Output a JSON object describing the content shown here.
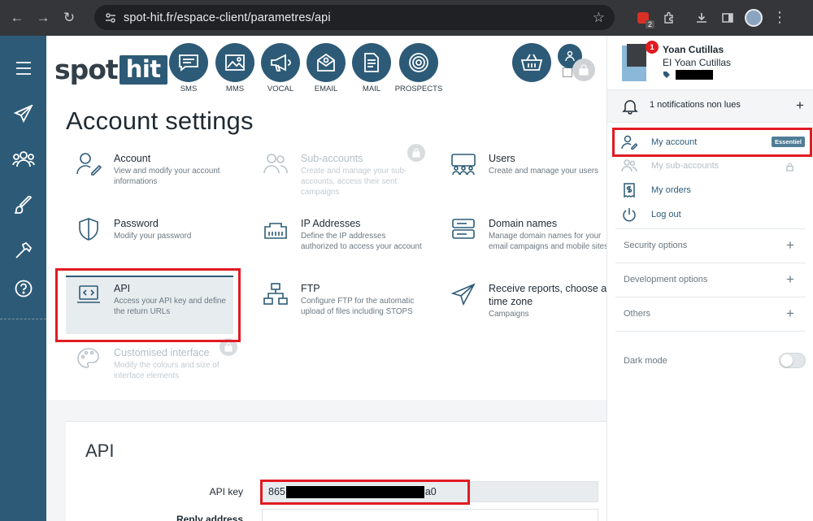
{
  "browser": {
    "url": "spot-hit.fr/espace-client/parametres/api",
    "extension_badge": "2"
  },
  "logo": {
    "part1": "spot",
    "part2": "hit"
  },
  "services": [
    {
      "label": "SMS",
      "icon": "sms-icon"
    },
    {
      "label": "MMS",
      "icon": "image-icon"
    },
    {
      "label": "VOCAL",
      "icon": "megaphone-icon"
    },
    {
      "label": "EMAIL",
      "icon": "email-icon"
    },
    {
      "label": "MAIL",
      "icon": "letter-icon"
    },
    {
      "label": "PROSPECTS",
      "icon": "target-icon"
    }
  ],
  "page": {
    "title": "Account settings"
  },
  "tiles": [
    {
      "title": "Account",
      "desc": "View and modify your account informations",
      "icon": "user-edit-icon"
    },
    {
      "title": "Sub-accounts",
      "desc": "Create and manage your sub-accounts, access their sent campaigns",
      "icon": "users-icon",
      "disabled": true
    },
    {
      "title": "Users",
      "desc": "Create and manage your users",
      "icon": "team-icon"
    },
    {
      "title": "Password",
      "desc": "Modify your password",
      "icon": "shield-icon"
    },
    {
      "title": "IP Addresses",
      "desc": "Define the IP addresses authorized to access your account",
      "icon": "network-port-icon"
    },
    {
      "title": "Domain names",
      "desc": "Manage domain names for your email campaigns and mobile sites",
      "icon": "server-icon"
    },
    {
      "title": "API",
      "desc": "Access your API key and define the return URLs",
      "icon": "code-laptop-icon"
    },
    {
      "title": "FTP",
      "desc": "Configure FTP for the automatic upload of files including STOPS",
      "icon": "ftp-network-icon"
    },
    {
      "title": "Receive reports, choose a time zone",
      "desc": "Campaigns",
      "icon": "paper-plane-icon"
    },
    {
      "title": "Customised interface",
      "desc": "Modify the colours and size of interface elements",
      "icon": "palette-icon",
      "disabled": true
    }
  ],
  "api_section": {
    "heading": "API",
    "api_key_label": "API key",
    "api_key_prefix": "865",
    "api_key_suffix": "a0",
    "reply_label": "Reply address"
  },
  "panel": {
    "notif_count": "1",
    "user_name": "Yoan Cutillas",
    "company": "EI Yoan Cutillas",
    "notifications_text": "1 notifications non lues",
    "menu": [
      {
        "label": "My account",
        "badge": "Essentiel",
        "icon": "user-edit-icon"
      },
      {
        "label": "My sub-accounts",
        "icon": "users-icon",
        "disabled": true
      },
      {
        "label": "My orders",
        "icon": "invoice-icon"
      },
      {
        "label": "Log out",
        "icon": "power-icon"
      }
    ],
    "sections": [
      "Security options",
      "Development options",
      "Others"
    ],
    "dark_mode_label": "Dark mode",
    "dark_mode_on": false
  },
  "colors": {
    "brand": "#2d5b77",
    "highlight": "#e11b22"
  }
}
